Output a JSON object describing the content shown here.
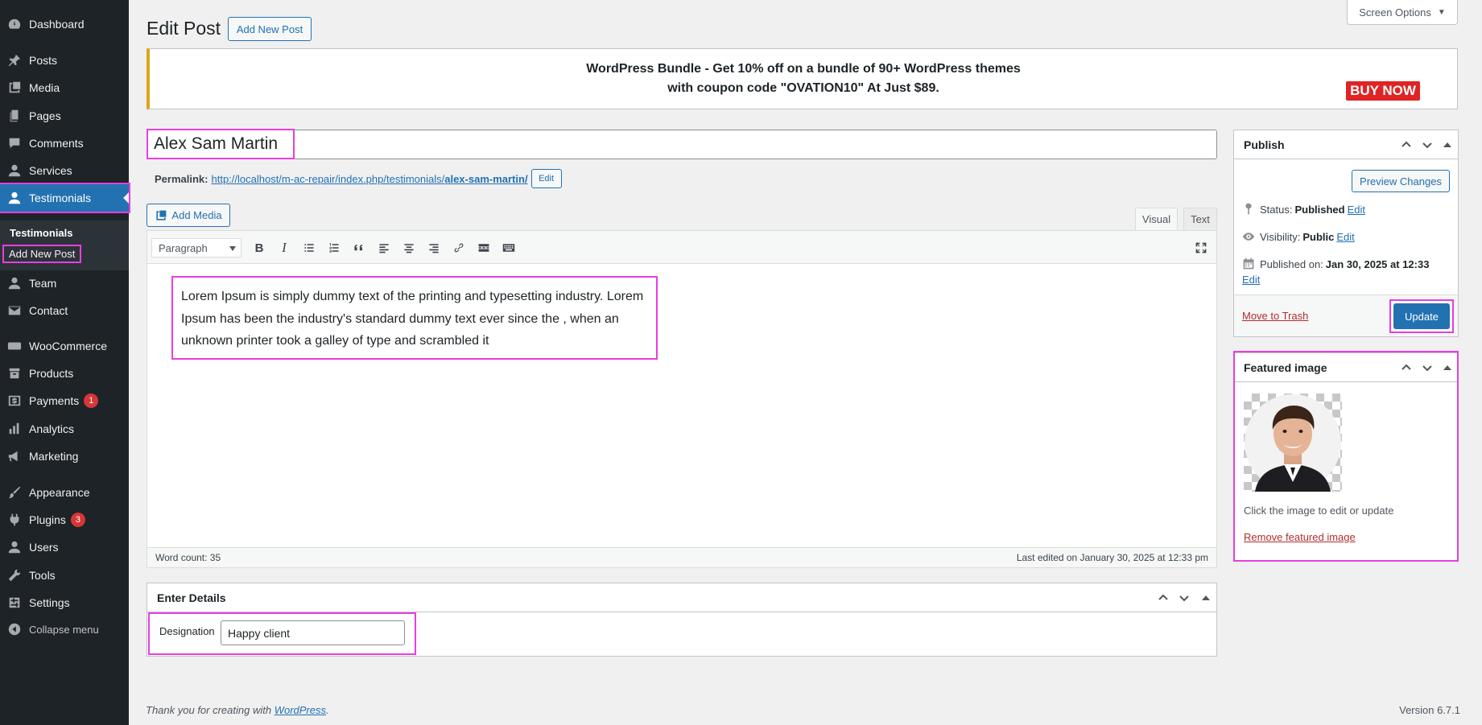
{
  "sidebar": {
    "items": [
      {
        "label": "Dashboard",
        "icon": "dashboard-icon"
      },
      {
        "label": "Posts",
        "icon": "pin-icon"
      },
      {
        "label": "Media",
        "icon": "media-icon"
      },
      {
        "label": "Pages",
        "icon": "pages-icon"
      },
      {
        "label": "Comments",
        "icon": "comment-icon"
      },
      {
        "label": "Services",
        "icon": "user-icon"
      },
      {
        "label": "Testimonials",
        "icon": "user-icon"
      },
      {
        "label": "Team",
        "icon": "user-icon"
      },
      {
        "label": "Contact",
        "icon": "mail-icon"
      },
      {
        "label": "WooCommerce",
        "icon": "woo-icon"
      },
      {
        "label": "Products",
        "icon": "archive-icon"
      },
      {
        "label": "Payments",
        "icon": "dollar-icon",
        "badge": "1"
      },
      {
        "label": "Analytics",
        "icon": "bar-chart-icon"
      },
      {
        "label": "Marketing",
        "icon": "megaphone-icon"
      },
      {
        "label": "Appearance",
        "icon": "brush-icon"
      },
      {
        "label": "Plugins",
        "icon": "plugin-icon",
        "badge": "3"
      },
      {
        "label": "Users",
        "icon": "user-icon"
      },
      {
        "label": "Tools",
        "icon": "wrench-icon"
      },
      {
        "label": "Settings",
        "icon": "settings-icon"
      },
      {
        "label": "Collapse menu",
        "icon": "collapse-icon"
      }
    ],
    "submenu": [
      "Testimonials",
      "Add New Post"
    ]
  },
  "header": {
    "screen_options": "Screen Options",
    "title": "Edit Post",
    "add_new": "Add New Post"
  },
  "banner": {
    "line1": "WordPress Bundle - Get 10% off on a bundle of 90+ WordPress themes",
    "line2": "with coupon code \"OVATION10\" At Just $89.",
    "buy_now": "BUY NOW"
  },
  "post": {
    "title": "Alex Sam Martin",
    "permalink_label": "Permalink:",
    "permalink_base": "http://localhost/m-ac-repair/index.php/testimonials/",
    "permalink_slug": "alex-sam-martin/",
    "permalink_edit": "Edit"
  },
  "editor": {
    "add_media": "Add Media",
    "tab_visual": "Visual",
    "tab_text": "Text",
    "format": "Paragraph",
    "content": "Lorem Ipsum is simply dummy text of the printing and typesetting industry. Lorem Ipsum has been the industry's standard dummy text ever since the , when an unknown printer took a galley of type and scrambled it",
    "word_count": "Word count: 35",
    "last_edited": "Last edited on January 30, 2025 at 12:33 pm"
  },
  "details": {
    "title": "Enter Details",
    "designation_label": "Designation",
    "designation_value": "Happy client"
  },
  "publish": {
    "title": "Publish",
    "preview": "Preview Changes",
    "status_label": "Status:",
    "status_value": "Published",
    "visibility_label": "Visibility:",
    "visibility_value": "Public",
    "published_label": "Published on:",
    "published_value": "Jan 30, 2025 at 12:33",
    "edit": "Edit",
    "trash": "Move to Trash",
    "update": "Update"
  },
  "featured": {
    "title": "Featured image",
    "hint": "Click the image to edit or update",
    "remove": "Remove featured image"
  },
  "footer": {
    "thanks": "Thank you for creating with ",
    "wordpress": "WordPress",
    "period": ".",
    "version": "Version 6.7.1"
  },
  "colors": {
    "sidebar_bg": "#1d2327",
    "accent": "#2271b1",
    "highlight": "#e83ee0",
    "danger": "#d63638"
  }
}
